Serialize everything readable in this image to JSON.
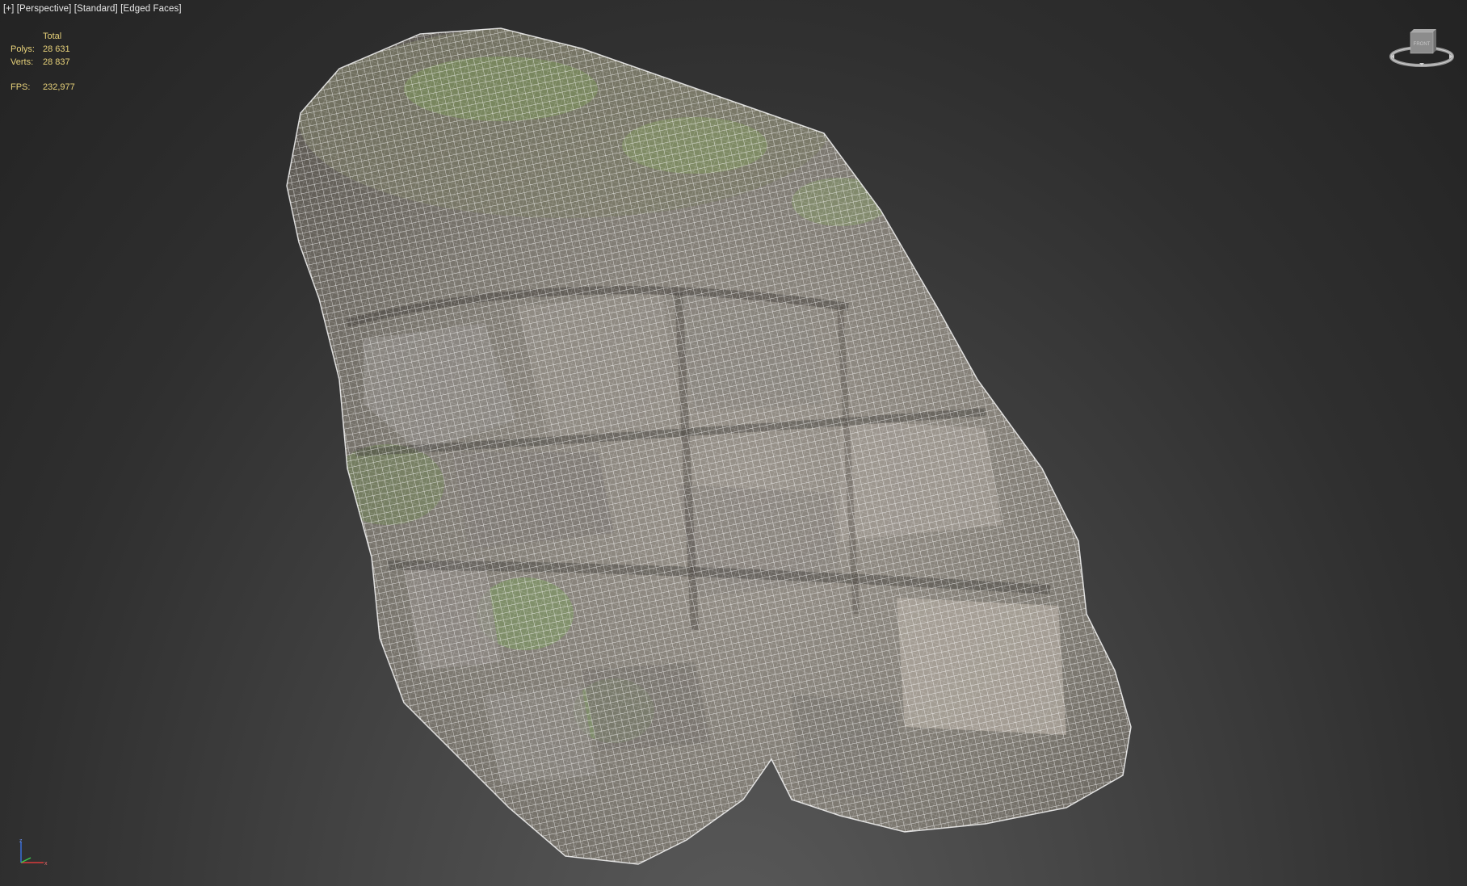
{
  "viewport": {
    "label_parts": [
      "[+]",
      "[Perspective]",
      "[Standard]",
      "[Edged Faces]"
    ],
    "stats": {
      "header": "Total",
      "polys_label": "Polys:",
      "polys_value": "28 631",
      "verts_label": "Verts:",
      "verts_value": "28 837",
      "fps_label": "FPS:",
      "fps_value": "232,977"
    },
    "viewcube_face_label": "FRONT"
  },
  "colors": {
    "stats_text": "#e8d27a",
    "label_text": "#e6e6e6",
    "background_dark": "#232323",
    "background_light": "#5a5a5a",
    "wireframe": "#ffffff",
    "rock_base": "#8a8680",
    "moss": "#7ea05a"
  },
  "icons": {
    "viewcube": "viewcube-icon",
    "axis": "axis-tripod-icon"
  }
}
